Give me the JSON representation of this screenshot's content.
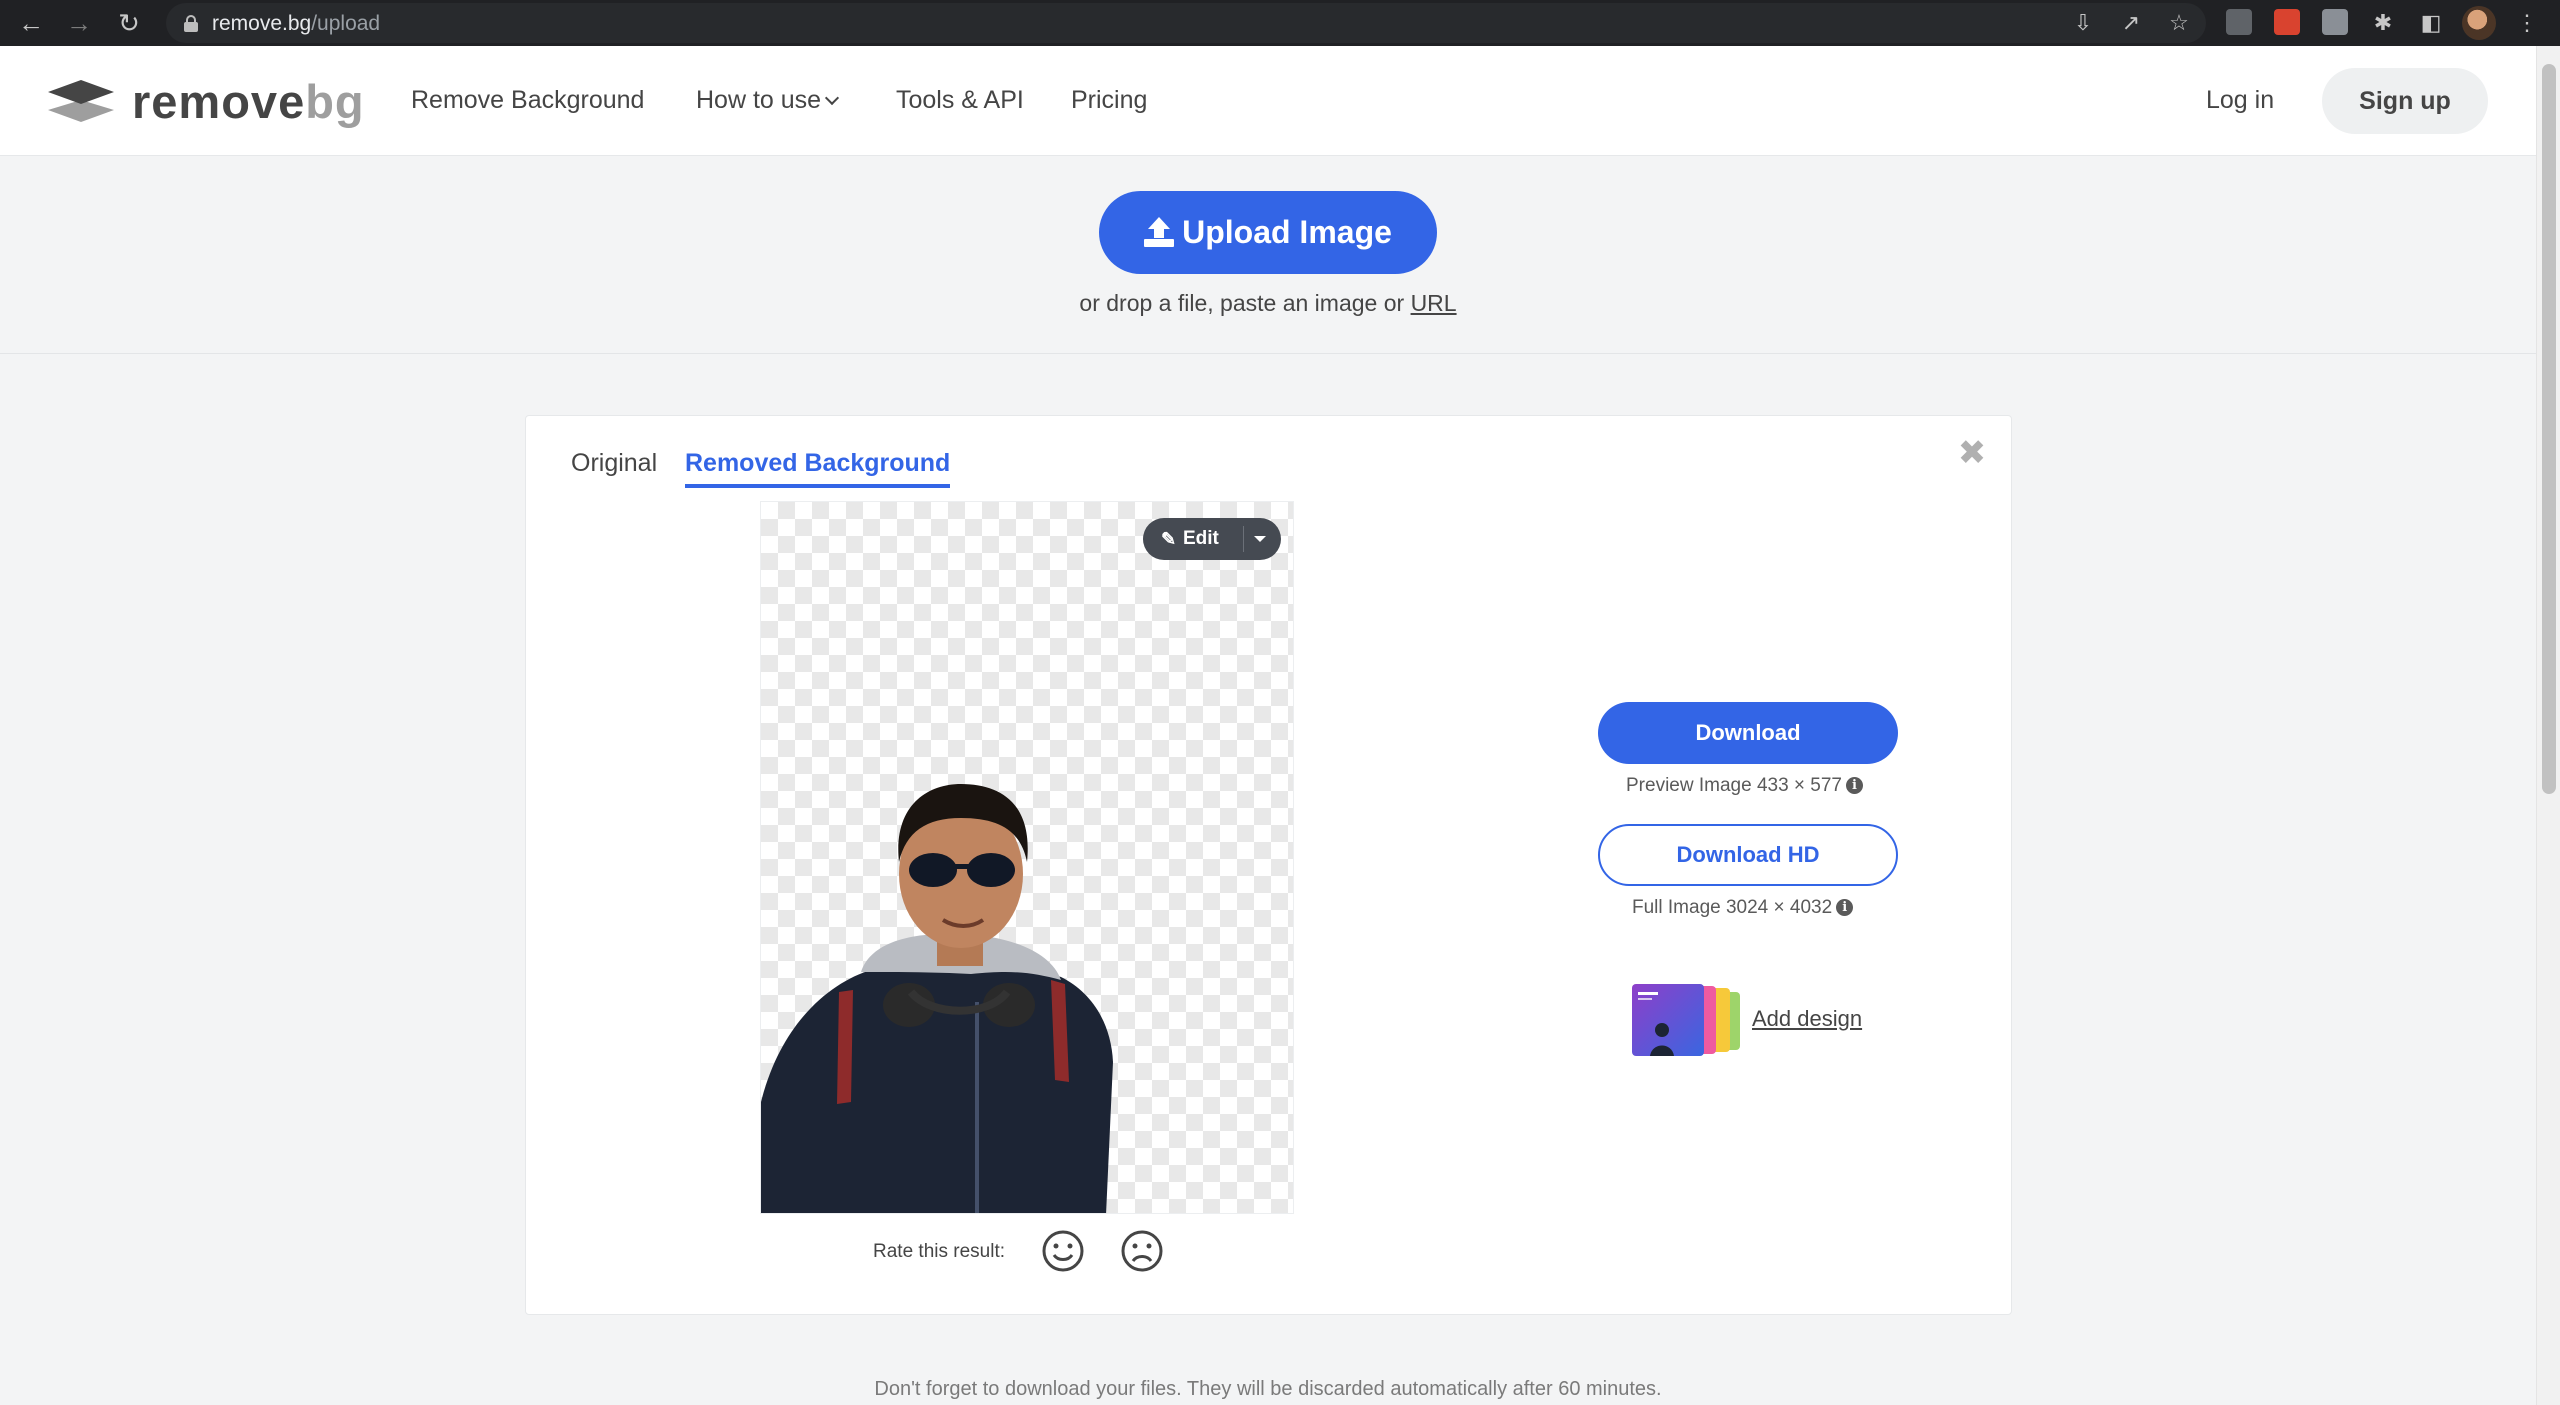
{
  "browser": {
    "url_host": "remove.bg",
    "url_path": "/upload",
    "icons": [
      "back-icon",
      "forward-icon",
      "reload-icon",
      "lock-icon",
      "install-icon",
      "share-icon",
      "star-icon",
      "extensions-icon",
      "side-panel-icon",
      "menu-icon"
    ]
  },
  "header": {
    "logo_main": "remove",
    "logo_suffix": "bg",
    "nav": {
      "remove_background": "Remove Background",
      "how_to_use": "How to use",
      "tools_api": "Tools & API",
      "pricing": "Pricing"
    },
    "login": "Log in",
    "signup": "Sign up"
  },
  "upload": {
    "button_label": "Upload Image",
    "hint_prefix": "or drop a file, paste an image or",
    "hint_link": "URL"
  },
  "result": {
    "tabs": {
      "original": "Original",
      "removed": "Removed Background"
    },
    "active_tab": "Removed Background",
    "edit_label": "Edit",
    "rate_label": "Rate this result:",
    "download_label": "Download",
    "preview_info": "Preview Image 433 × 577",
    "download_hd_label": "Download HD",
    "full_info": "Full Image 3024 × 4032",
    "add_design": "Add design"
  },
  "footer_note": "Don't forget to download your files. They will be discarded automatically after 60 minutes.",
  "colors": {
    "accent": "#3365e6",
    "text": "#454545",
    "page_bg": "#f3f4f5"
  }
}
